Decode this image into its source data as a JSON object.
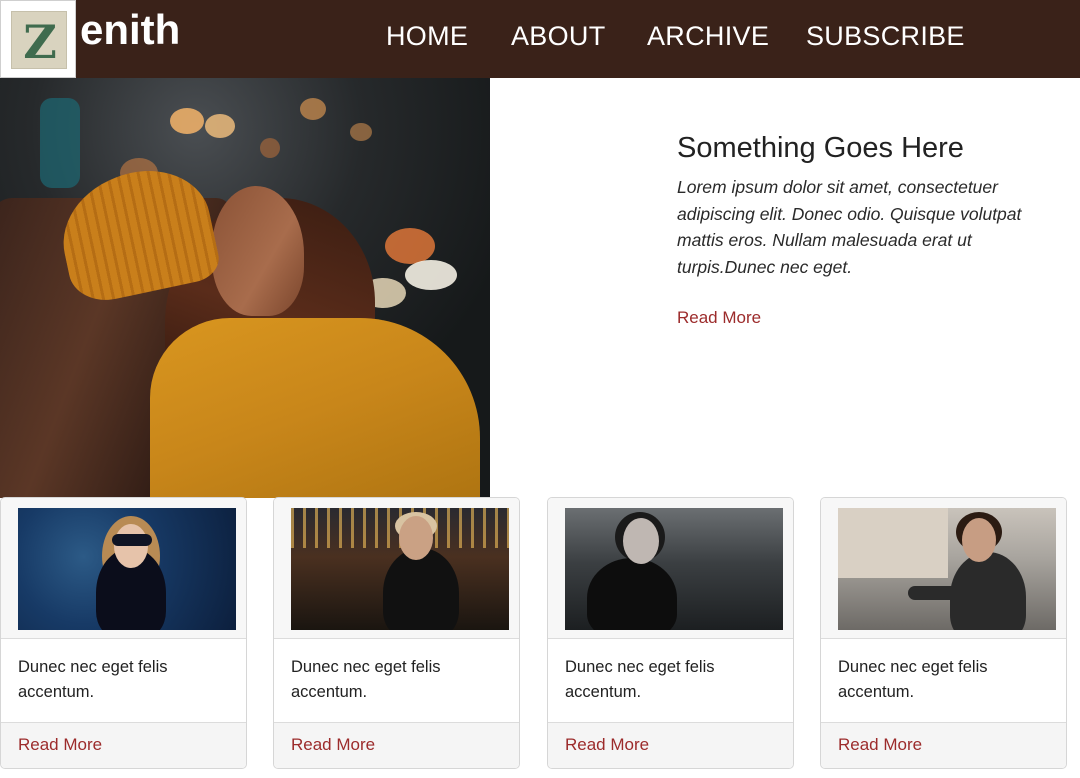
{
  "header": {
    "logo_letter": "Z",
    "brand_suffix": "enith",
    "nav": [
      "HOME",
      "ABOUT",
      "ARCHIVE",
      "SUBSCRIBE"
    ]
  },
  "featured": {
    "title": "Something Goes Here",
    "body": "Lorem ipsum dolor sit amet, consectetuer adipiscing elit. Donec odio. Quisque volutpat mattis eros. Nullam malesuada erat ut turpis.Dunec nec eget.",
    "link": "Read More"
  },
  "cards": [
    {
      "text": "Dunec nec eget felis accentum.",
      "link": "Read More"
    },
    {
      "text": "Dunec nec eget felis accentum.",
      "link": "Read More"
    },
    {
      "text": "Dunec nec eget felis accentum.",
      "link": "Read More"
    },
    {
      "text": "Dunec nec eget felis accentum.",
      "link": "Read More"
    }
  ],
  "colors": {
    "header_bg": "#3a2219",
    "link": "#9c2b2b"
  }
}
